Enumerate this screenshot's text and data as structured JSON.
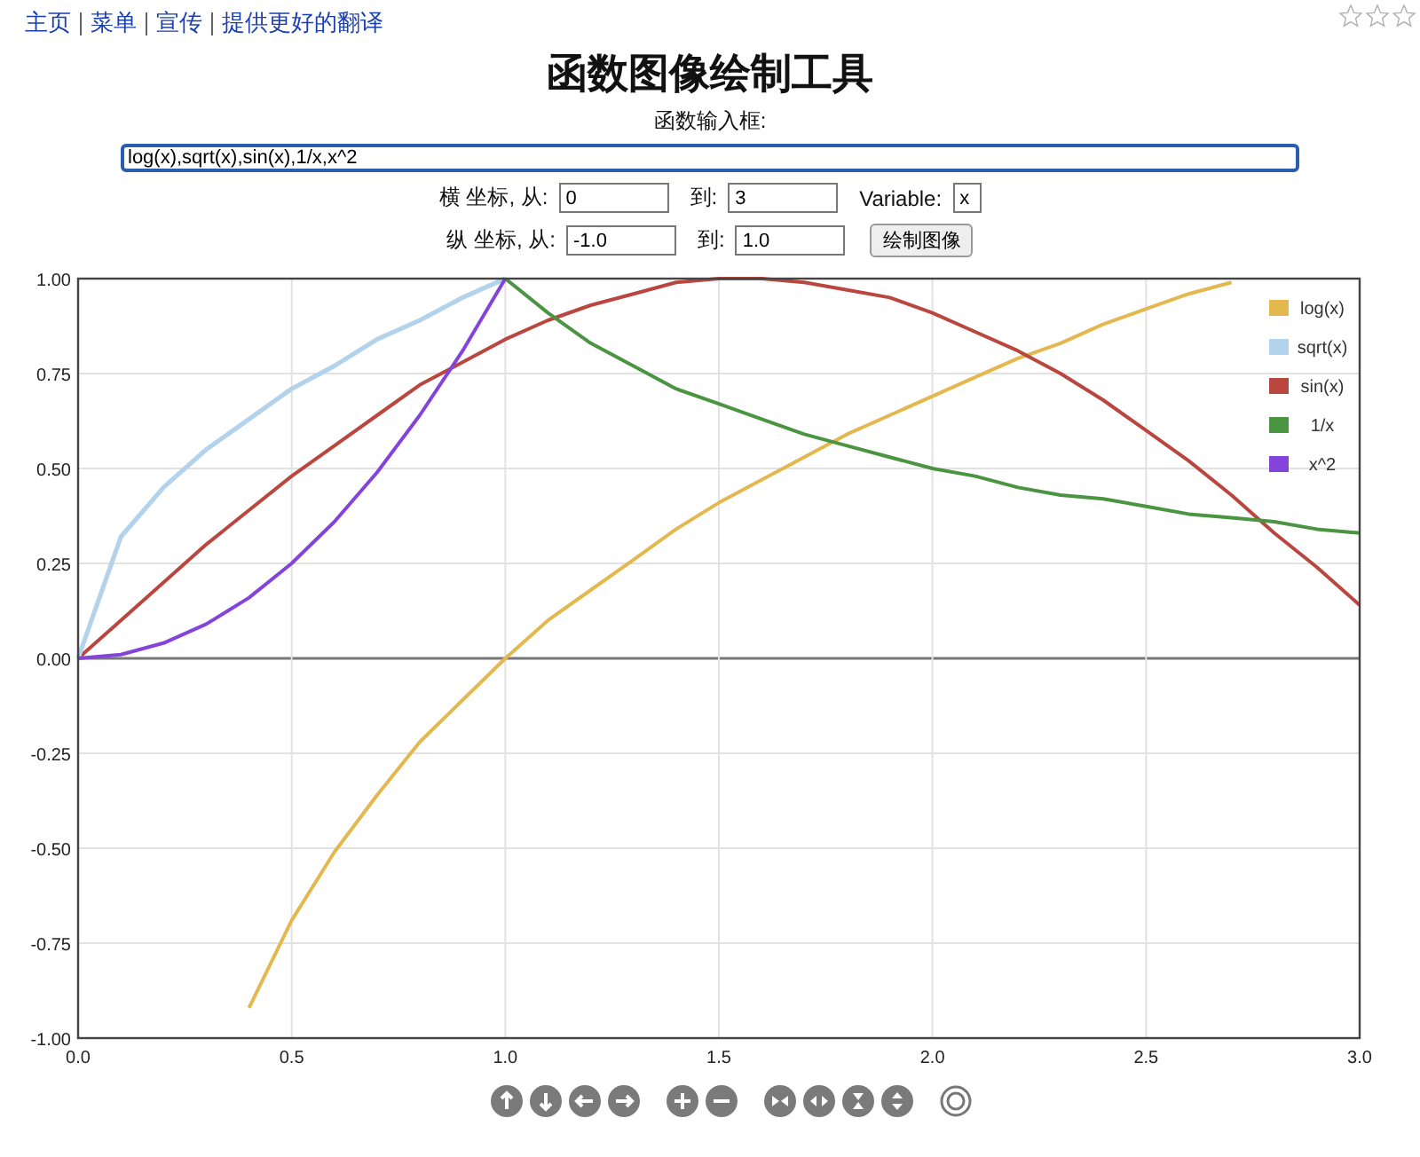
{
  "nav": {
    "links": [
      "主页",
      "菜单",
      "宣传",
      "提供更好的翻译"
    ]
  },
  "rating": {
    "stars": 0
  },
  "title": "函数图像绘制工具",
  "function_input": {
    "label": "函数输入框:",
    "value": "log(x),sqrt(x),sin(x),1/x,x^2"
  },
  "x_range": {
    "label": "横 坐标, 从:",
    "from": "0",
    "to_label": "到:",
    "to": "3",
    "variable_label": "Variable:",
    "variable": "x"
  },
  "y_range": {
    "label": "纵 坐标, 从:",
    "from": "-1.0",
    "to_label": "到:",
    "to": "1.0",
    "button": "绘制图像"
  },
  "chart_data": {
    "type": "line",
    "x": [
      0,
      0.1,
      0.2,
      0.3,
      0.4,
      0.5,
      0.6,
      0.7,
      0.8,
      0.9,
      1,
      1.1,
      1.2,
      1.3,
      1.4,
      1.5,
      1.6,
      1.7,
      1.8,
      1.9,
      2,
      2.1,
      2.2,
      2.3,
      2.4,
      2.5,
      2.6,
      2.7,
      2.8,
      2.9,
      3
    ],
    "xlim": [
      0,
      3
    ],
    "ylim": [
      -1,
      1
    ],
    "grid": true,
    "legend": true,
    "xticks": [
      {
        "value": 0,
        "label": "0.0"
      },
      {
        "value": 0.5,
        "label": "0.5"
      },
      {
        "value": 1,
        "label": "1.0"
      },
      {
        "value": 1.5,
        "label": "1.5"
      },
      {
        "value": 2,
        "label": "2.0"
      },
      {
        "value": 2.5,
        "label": "2.5"
      },
      {
        "value": 3,
        "label": "3.0"
      }
    ],
    "yticks": [
      {
        "value": 1,
        "label": "1.00"
      },
      {
        "value": 0.75,
        "label": "0.75"
      },
      {
        "value": 0.5,
        "label": "0.50"
      },
      {
        "value": 0.25,
        "label": "0.25"
      },
      {
        "value": 0,
        "label": "0.00"
      },
      {
        "value": -0.25,
        "label": "-0.25"
      },
      {
        "value": -0.5,
        "label": "-0.50"
      },
      {
        "value": -0.75,
        "label": "-0.75"
      },
      {
        "value": -1,
        "label": "-1.00"
      }
    ],
    "series": [
      {
        "name": "log(x)",
        "color": "#e3b84e",
        "values": [
          null,
          null,
          null,
          null,
          -0.92,
          -0.69,
          -0.51,
          -0.36,
          -0.22,
          -0.11,
          0,
          0.1,
          0.18,
          0.26,
          0.34,
          0.41,
          0.47,
          0.53,
          0.59,
          0.64,
          0.69,
          0.74,
          0.79,
          0.83,
          0.88,
          0.92,
          0.96,
          0.99,
          null,
          null,
          null
        ]
      },
      {
        "name": "sqrt(x)",
        "color": "#b3d3ec",
        "values": [
          0,
          0.32,
          0.45,
          0.55,
          0.63,
          0.71,
          0.77,
          0.84,
          0.89,
          0.95,
          1,
          null,
          null,
          null,
          null,
          null,
          null,
          null,
          null,
          null,
          null,
          null,
          null,
          null,
          null,
          null,
          null,
          null,
          null,
          null,
          null
        ]
      },
      {
        "name": "sin(x)",
        "color": "#b9463f",
        "values": [
          0,
          0.1,
          0.2,
          0.3,
          0.39,
          0.48,
          0.56,
          0.64,
          0.72,
          0.78,
          0.84,
          0.89,
          0.93,
          0.96,
          0.99,
          1,
          1,
          0.99,
          0.97,
          0.95,
          0.91,
          0.86,
          0.81,
          0.75,
          0.68,
          0.6,
          0.52,
          0.43,
          0.33,
          0.24,
          0.14
        ]
      },
      {
        "name": "1/x",
        "color": "#4a9442",
        "values": [
          null,
          null,
          null,
          null,
          null,
          null,
          null,
          null,
          null,
          null,
          1,
          0.91,
          0.83,
          0.77,
          0.71,
          0.67,
          0.63,
          0.59,
          0.56,
          0.53,
          0.5,
          0.48,
          0.45,
          0.43,
          0.42,
          0.4,
          0.38,
          0.37,
          0.36,
          0.34,
          0.33
        ]
      },
      {
        "name": "x^2",
        "color": "#8444dc",
        "values": [
          0,
          0.01,
          0.04,
          0.09,
          0.16,
          0.25,
          0.36,
          0.49,
          0.64,
          0.81,
          1,
          null,
          null,
          null,
          null,
          null,
          null,
          null,
          null,
          null,
          null,
          null,
          null,
          null,
          null,
          null,
          null,
          null,
          null,
          null,
          null
        ]
      }
    ]
  }
}
